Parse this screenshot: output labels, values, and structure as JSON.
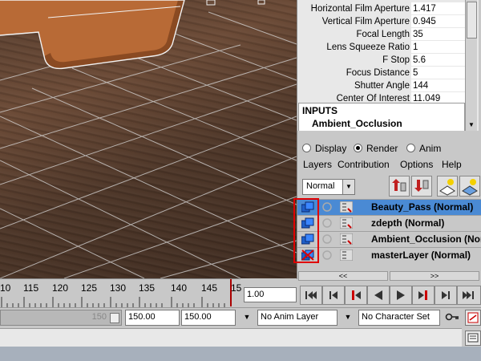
{
  "attributes": [
    {
      "label": "Horizontal Film Aperture",
      "value": "1.417"
    },
    {
      "label": "Vertical Film Aperture",
      "value": "0.945"
    },
    {
      "label": "Focal Length",
      "value": "35"
    },
    {
      "label": "Lens Squeeze Ratio",
      "value": "1"
    },
    {
      "label": "F Stop",
      "value": "5.6"
    },
    {
      "label": "Focus Distance",
      "value": "5"
    },
    {
      "label": "Shutter Angle",
      "value": "144"
    },
    {
      "label": "Center Of Interest",
      "value": "11.049"
    }
  ],
  "inputs": {
    "title": "INPUTS",
    "item": "Ambient_Occlusion"
  },
  "layer_editor": {
    "modes": [
      {
        "label": "Display",
        "selected": false
      },
      {
        "label": "Render",
        "selected": true
      },
      {
        "label": "Anim",
        "selected": false
      }
    ],
    "menu": [
      "Layers",
      "Contribution",
      "Options",
      "Help"
    ],
    "blend_mode": "Normal",
    "layers": [
      {
        "name": "Beauty_Pass (Normal)",
        "selected": true,
        "renderable": true
      },
      {
        "name": "zdepth (Normal)",
        "selected": false,
        "renderable": true
      },
      {
        "name": "Ambient_Occlusion (Normal)",
        "selected": false,
        "renderable": true
      },
      {
        "name": "masterLayer (Normal)",
        "selected": false,
        "renderable": false
      }
    ],
    "nav_left": "<<",
    "nav_right": ">>"
  },
  "time_slider": {
    "ticks": [
      "10",
      "115",
      "120",
      "125",
      "130",
      "135",
      "140",
      "145",
      "15"
    ],
    "current_frame": "1.00"
  },
  "range": {
    "slider_end": "150",
    "end_time": "150.00",
    "playback_end": "150.00",
    "anim_layer": "No Anim Layer",
    "character_set": "No Character Set"
  },
  "colors": {
    "selected_row": "#4a8ad4",
    "highlight_box": "#e00000"
  }
}
